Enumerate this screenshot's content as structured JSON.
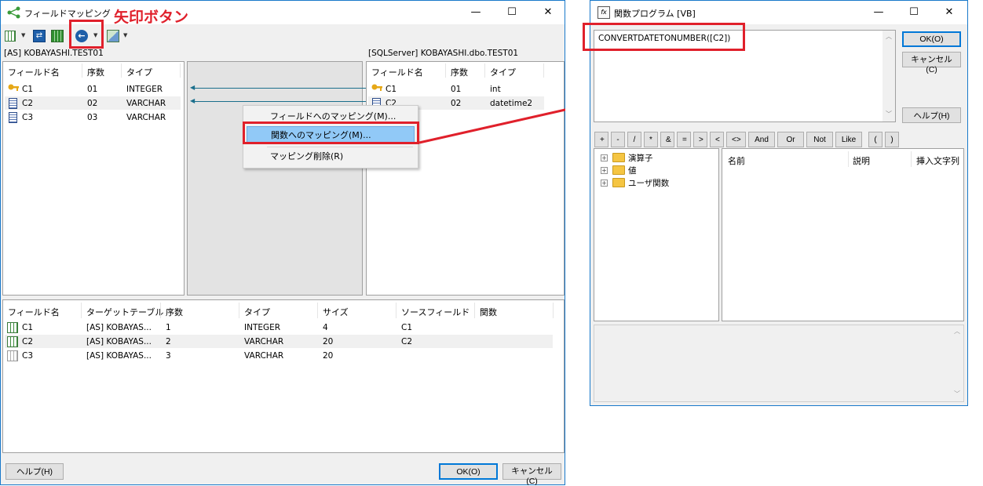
{
  "left_window": {
    "title": "フィールドマッピング",
    "caption": {
      "minimize": "—",
      "maximize": "☐",
      "close": "✕"
    },
    "toolbar_icons": [
      "field-grid-icon",
      "dropdown-arrow-icon",
      "swap-icon",
      "table-icon",
      "arrow-left-circle-icon",
      "dropdown-arrow-icon",
      "mapping-icon",
      "dropdown-arrow-icon"
    ],
    "annotation_label": "矢印ボタン",
    "source": {
      "header": "[AS] KOBAYASHI.TEST01",
      "columns": [
        "フィールド名",
        "序数",
        "タイプ"
      ],
      "rows": [
        {
          "icon": "key-icon",
          "name": "C1",
          "ordinal": "01",
          "type": "INTEGER"
        },
        {
          "icon": "field-icon",
          "name": "C2",
          "ordinal": "02",
          "type": "VARCHAR"
        },
        {
          "icon": "field-icon",
          "name": "C3",
          "ordinal": "03",
          "type": "VARCHAR"
        }
      ]
    },
    "target": {
      "header": "[SQLServer] KOBAYASHI.dbo.TEST01",
      "columns": [
        "フィールド名",
        "序数",
        "タイプ"
      ],
      "rows": [
        {
          "icon": "key-icon",
          "name": "C1",
          "ordinal": "01",
          "type": "int"
        },
        {
          "icon": "field-icon",
          "name": "C2",
          "ordinal": "02",
          "type": "datetime2"
        }
      ]
    },
    "context_menu": {
      "items": [
        {
          "label": "フィールドへのマッピング(M)..."
        },
        {
          "label": "関数へのマッピング(M)..."
        },
        {
          "label": "マッピング削除(R)"
        }
      ]
    },
    "result": {
      "columns": [
        "フィールド名",
        "ターゲットテーブル",
        "序数",
        "タイプ",
        "サイズ",
        "ソースフィールド",
        "関数"
      ],
      "rows": [
        {
          "name": "C1",
          "target_table": "[AS] KOBAYAS...",
          "ordinal": "1",
          "type": "INTEGER",
          "size": "4",
          "source_field": "C1",
          "function": ""
        },
        {
          "name": "C2",
          "target_table": "[AS] KOBAYAS...",
          "ordinal": "2",
          "type": "VARCHAR",
          "size": "20",
          "source_field": "C2",
          "function": ""
        },
        {
          "name": "C3",
          "target_table": "[AS] KOBAYAS...",
          "ordinal": "3",
          "type": "VARCHAR",
          "size": "20",
          "source_field": "",
          "function": ""
        }
      ]
    },
    "buttons": {
      "help": "ヘルプ(H)",
      "ok": "OK(O)",
      "cancel": "キャンセル(C)"
    }
  },
  "right_window": {
    "title": "関数プログラム [VB]",
    "caption": {
      "minimize": "—",
      "maximize": "☐",
      "close": "✕"
    },
    "expression": "CONVERTDATETONUMBER([C2])",
    "buttons": {
      "ok": "OK(O)",
      "cancel": "キャンセル(C)",
      "help": "ヘルプ(H)"
    },
    "operators": [
      "+",
      "-",
      "/",
      "*",
      "&",
      "=",
      ">",
      "<",
      "<>",
      "And",
      "Or",
      "Not",
      "Like",
      "(",
      ")"
    ],
    "tree": [
      {
        "label": "演算子"
      },
      {
        "label": "値"
      },
      {
        "label": "ユーザ関数"
      }
    ],
    "list_columns": [
      "名前",
      "説明",
      "挿入文字列"
    ]
  },
  "colors": {
    "highlight_red": "#e0202b",
    "selection_blue": "#91c9f7",
    "window_border": "#1979ca",
    "mapping_line": "#1b6f8c"
  }
}
